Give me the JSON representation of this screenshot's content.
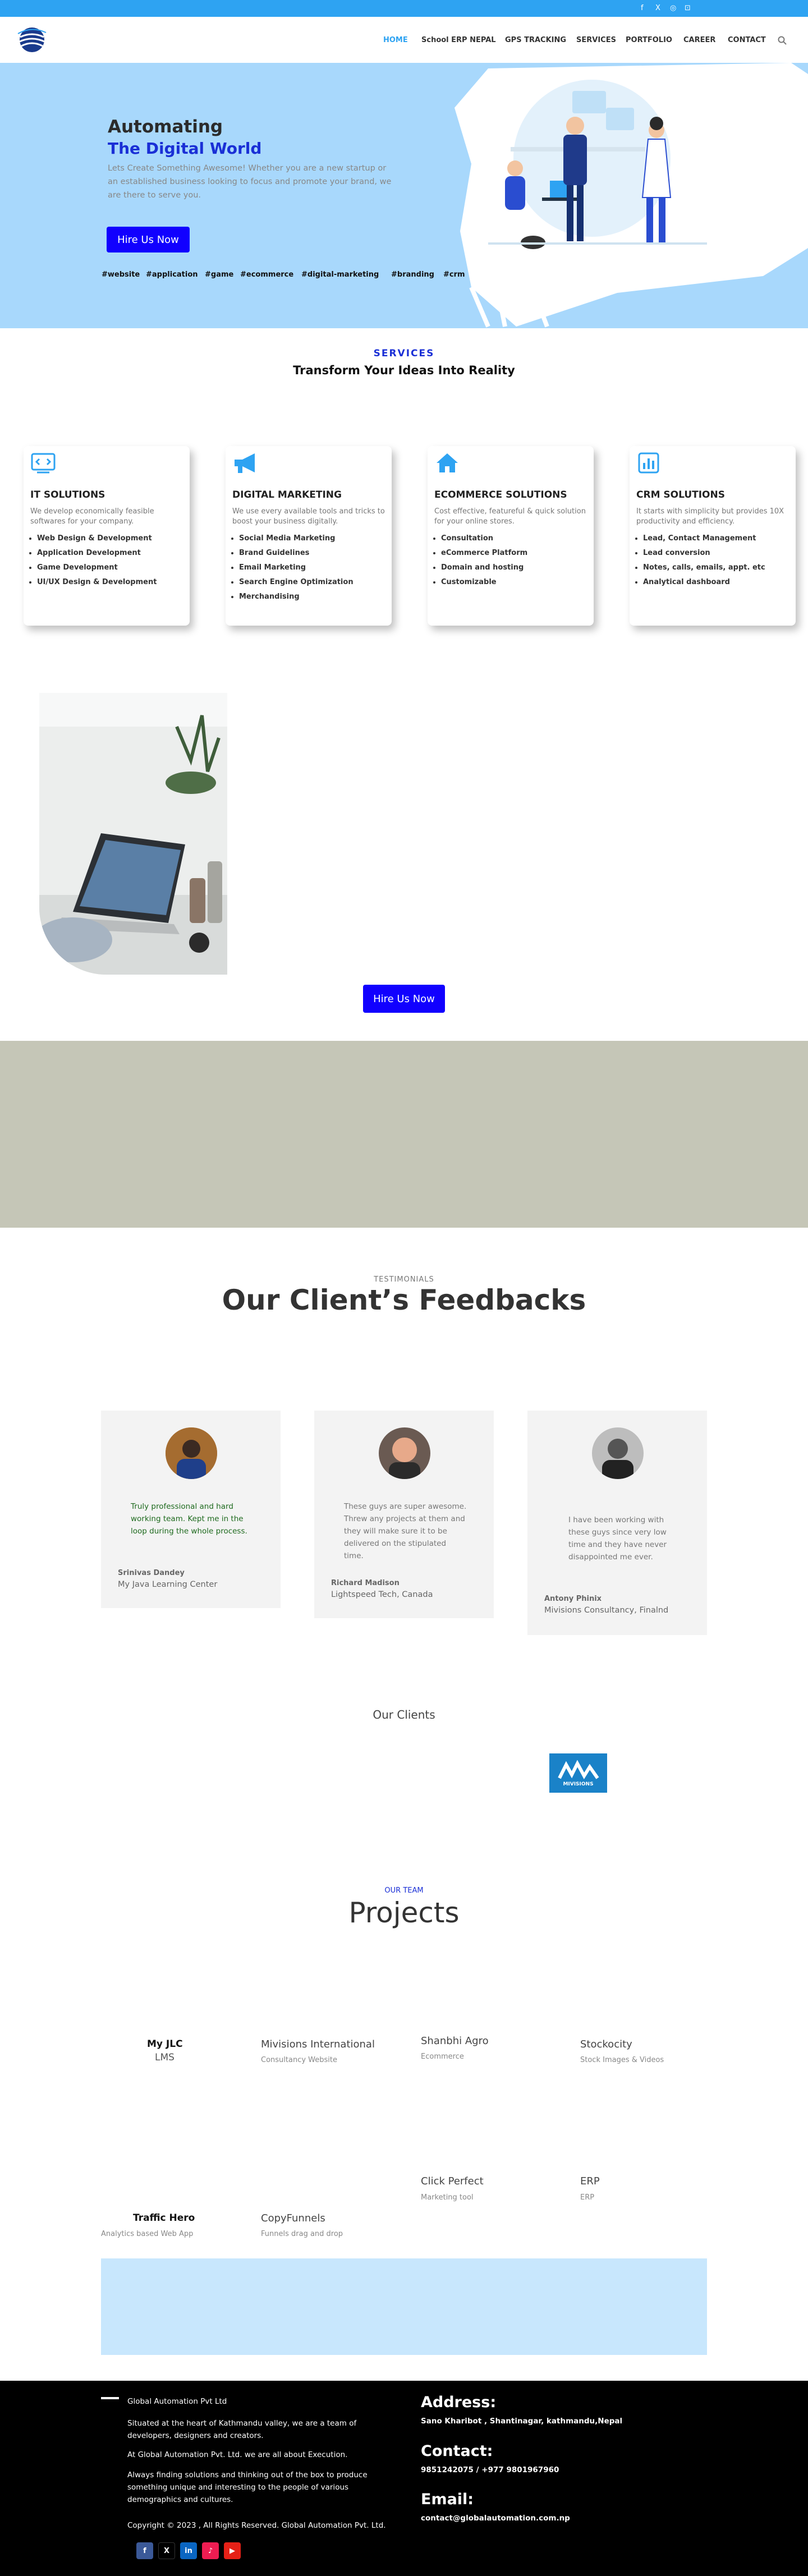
{
  "topbar": {
    "social": [
      "f",
      "X",
      "◎",
      "⊡"
    ]
  },
  "nav": {
    "logo_alt": "Global Automation",
    "items": [
      "HOME",
      "School ERP NEPAL",
      "GPS TRACKING",
      "SERVICES",
      "PORTFOLIO",
      "CAREER",
      "CONTACT"
    ],
    "search_icon": "search-icon"
  },
  "hero": {
    "title1": "Automating",
    "title2": "The Digital World",
    "body": "Lets Create Something Awesome! Whether you are a new startup or an established business looking to focus and promote your brand, we are there to serve you.",
    "cta": "Hire Us Now",
    "tags": [
      "#website",
      "#application",
      "#game",
      "#ecommerce",
      "#digital-marketing",
      "#branding",
      "#crm"
    ]
  },
  "services": {
    "eyebrow": "SERVICES",
    "heading": "Transform Your Ideas Into Reality",
    "cards": [
      {
        "icon": "code-icon",
        "title": "IT SOLUTIONS",
        "desc": "We develop economically feasible softwares for your company.",
        "items": [
          "Web Design & Development",
          "Application Development",
          "Game Development",
          "UI/UX Design & Development"
        ]
      },
      {
        "icon": "megaphone-icon",
        "title": "DIGITAL MARKETING",
        "desc": "We use every available tools and tricks to boost your business digitally.",
        "items": [
          "Social Media Marketing",
          "Brand Guidelines",
          "Email Marketing",
          "Search Engine Optimization",
          "Merchandising"
        ]
      },
      {
        "icon": "home-icon",
        "title": "ECOMMERCE SOLUTIONS",
        "desc": "Cost effective, featureful & quick solution for your online stores.",
        "items": [
          "Consultation",
          "eCommerce Platform",
          "Domain and hosting",
          "Customizable"
        ]
      },
      {
        "icon": "chart-icon",
        "title": "CRM SOLUTIONS",
        "desc": "It starts with simplicity but provides 10X productivity and efficiency.",
        "items": [
          "Lead, Contact Management",
          "Lead conversion",
          "Notes, calls, emails, appt. etc",
          "Analytical dashboard"
        ]
      }
    ]
  },
  "about": {
    "cta": "Hire Us Now"
  },
  "testimonials": {
    "eyebrow": "TESTIMONIALS",
    "heading": "Our Client’s Feedbacks",
    "items": [
      {
        "quote": "Truly professional and hard working team. Kept me in the loop during the whole process.",
        "name": "Srinivas Dandey",
        "org": "My Java Learning Center"
      },
      {
        "quote": "These guys are super awesome. Threw any projects at them and they will make sure it to be delivered on the stipulated time.",
        "name": "Richard Madison",
        "org": "Lightspeed Tech, Canada"
      },
      {
        "quote": "I have been working with these guys since very low time and they have never disappointed me ever.",
        "name": "Antony Phinix",
        "org": "Mivisions Consultancy, Finalnd"
      }
    ]
  },
  "clients": {
    "heading": "Our Clients",
    "logo_text": "MIVISIONS"
  },
  "projects": {
    "eyebrow": "OUR TEAM",
    "heading": "Projects",
    "row1": [
      {
        "title": "My JLC",
        "sub": "LMS"
      },
      {
        "title": "Mivisions International",
        "sub": "Consultancy Website"
      },
      {
        "title": "Shanbhi Agro",
        "sub": "Ecommerce"
      },
      {
        "title": "Stockocity",
        "sub": "Stock Images & Videos"
      }
    ],
    "row2": [
      {
        "title": "Click Perfect",
        "sub": "Marketing tool"
      },
      {
        "title": "ERP",
        "sub": "ERP"
      }
    ],
    "row3": [
      {
        "title": "Traffic Hero",
        "sub": "Analytics based Web App"
      },
      {
        "title": "CopyFunnels",
        "sub": "Funnels drag and drop"
      }
    ]
  },
  "footer": {
    "company": "Global Automation Pvt Ltd",
    "p1": "Situated at the heart of Kathmandu valley, we are a team of developers, designers and creators.",
    "p2": "At Global Automation Pvt. Ltd. we are all about Execution.",
    "p3": "Always finding solutions and thinking out of the box to produce something unique and interesting to the people of various demographics and cultures.",
    "copyright": "Copyright © 2023 , All Rights Reserved. Global Automation Pvt. Ltd.",
    "address_h": "Address:",
    "address": "Sano Kharibot , Shantinagar, kathmandu,Nepal",
    "contact_h": "Contact:",
    "contact": "9851242075 / +977 9801967960",
    "email_h": "Email:",
    "email": "contact@globalautomation.com.np",
    "social": [
      "f",
      "X",
      "in",
      "♪",
      "▶"
    ]
  },
  "colors": {
    "accent": "#2ea3f2",
    "cta": "#1100ff",
    "hero_bg": "#a8d8fc",
    "band": "#c5c6b7"
  }
}
